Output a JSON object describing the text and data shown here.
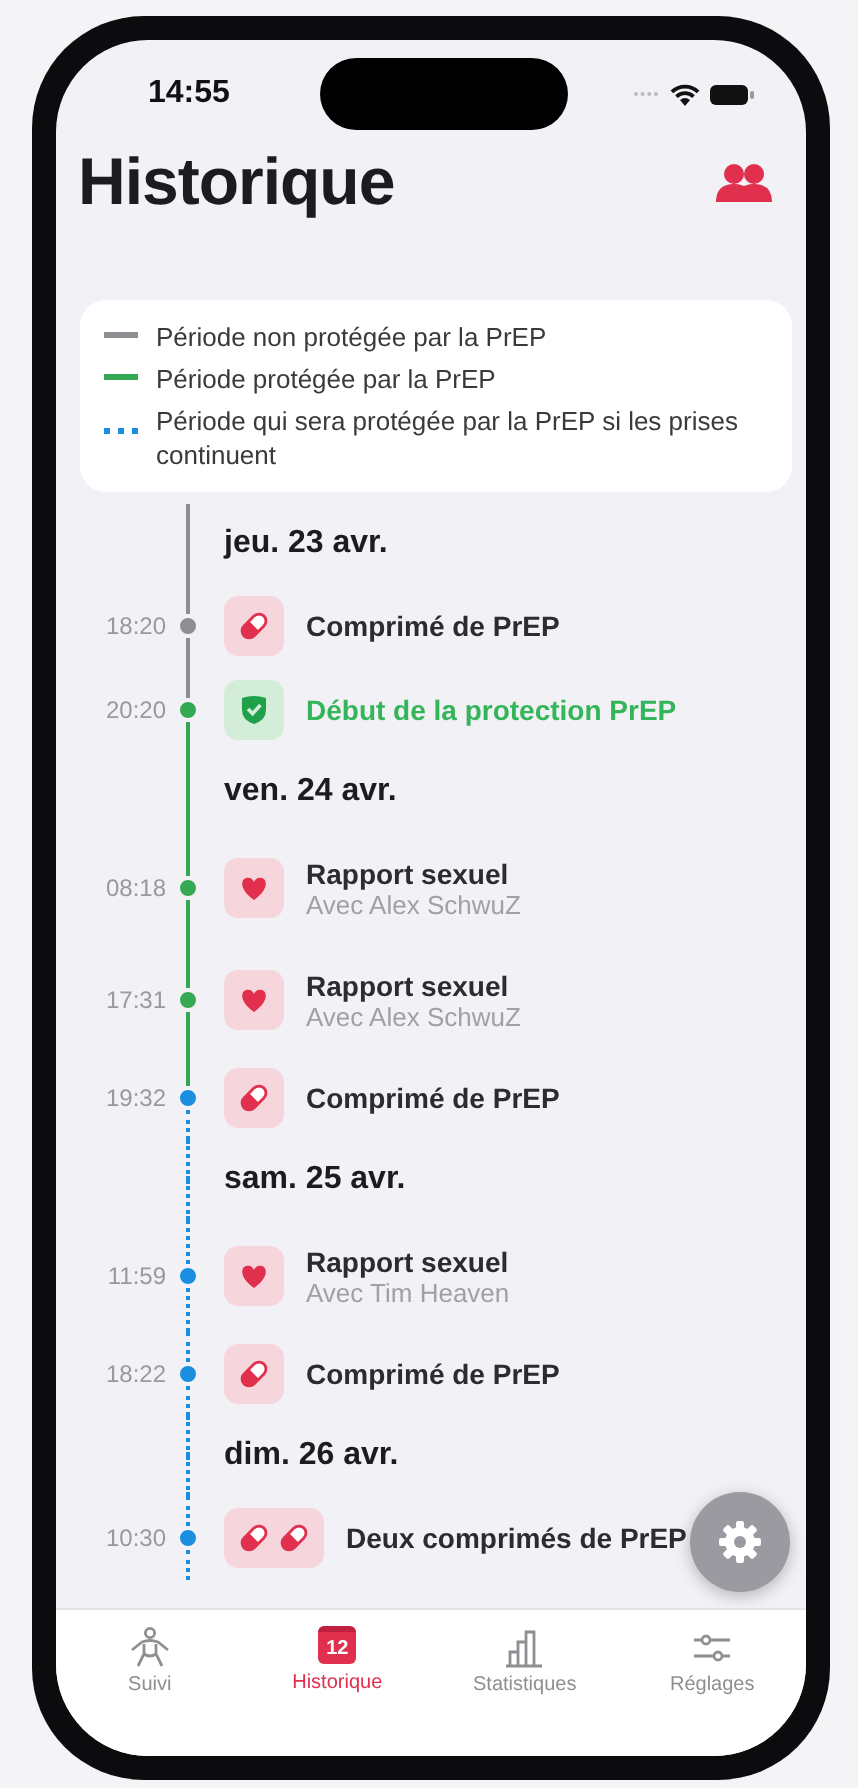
{
  "status_bar": {
    "time": "14:55"
  },
  "header": {
    "title": "Historique"
  },
  "legend": [
    {
      "kind": "solid",
      "color": "#8e8e93",
      "label": "Période non protégée par la PrEP"
    },
    {
      "kind": "solid",
      "color": "#34a853",
      "label": "Période protégée par la PrEP"
    },
    {
      "kind": "dotted",
      "color": "#1a8ee0",
      "label": "Période qui sera protégée par la PrEP si les prises continuent"
    }
  ],
  "timeline": [
    {
      "kind": "day",
      "label": "jeu. 23 avr.",
      "color": "#8e8e93",
      "dotted": false
    },
    {
      "kind": "pill",
      "time": "18:20",
      "title": "Comprimé de PrEP",
      "color": "#8e8e93",
      "dotted": false,
      "highlighted": false
    },
    {
      "kind": "protection",
      "time": "20:20",
      "title": "Début de la protection PrEP",
      "color": "#34a853",
      "dotted": false,
      "highlighted": true
    },
    {
      "kind": "day",
      "label": "ven. 24 avr.",
      "color": "#34a853",
      "dotted": false
    },
    {
      "kind": "intercourse",
      "time": "08:18",
      "title": "Rapport sexuel",
      "subtitle": "Avec Alex SchwuZ",
      "color": "#34a853",
      "dotted": false,
      "highlighted": false
    },
    {
      "kind": "intercourse",
      "time": "17:31",
      "title": "Rapport sexuel",
      "subtitle": "Avec Alex SchwuZ",
      "color": "#34a853",
      "dotted": false,
      "highlighted": false
    },
    {
      "kind": "pill",
      "time": "19:32",
      "title": "Comprimé de PrEP",
      "color": "#1a8ee0",
      "dotted": true,
      "highlighted": false
    },
    {
      "kind": "day",
      "label": "sam. 25 avr.",
      "color": "#1a8ee0",
      "dotted": true
    },
    {
      "kind": "intercourse",
      "time": "11:59",
      "title": "Rapport sexuel",
      "subtitle": "Avec Tim Heaven",
      "color": "#1a8ee0",
      "dotted": true,
      "highlighted": false
    },
    {
      "kind": "pill",
      "time": "18:22",
      "title": "Comprimé de PrEP",
      "color": "#1a8ee0",
      "dotted": true,
      "highlighted": false
    },
    {
      "kind": "day",
      "label": "dim. 26 avr.",
      "color": "#1a8ee0",
      "dotted": true
    },
    {
      "kind": "doublepill",
      "time": "10:30",
      "title": "Deux comprimés de PrEP",
      "color": "#1a8ee0",
      "dotted": true,
      "highlighted": false
    }
  ],
  "tabs": [
    {
      "kind": "person",
      "label": "Suivi",
      "selected": false
    },
    {
      "kind": "calendar",
      "label": "Historique",
      "selected": true,
      "badge": "12"
    },
    {
      "kind": "chart",
      "label": "Statistiques",
      "selected": false
    },
    {
      "kind": "sliders",
      "label": "Réglages",
      "selected": false
    }
  ]
}
